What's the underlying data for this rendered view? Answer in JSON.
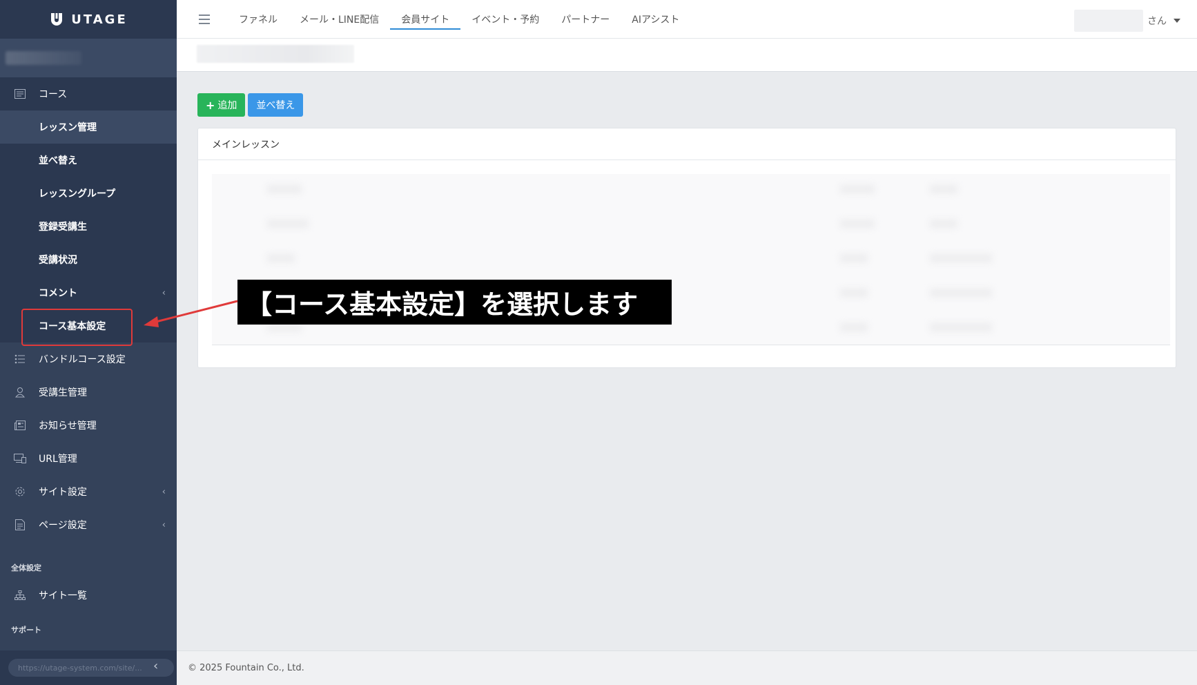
{
  "brand": {
    "name": "UTAGE"
  },
  "topbar": {
    "tabs": [
      {
        "label": "ファネル"
      },
      {
        "label": "メール・LINE配信"
      },
      {
        "label": "会員サイト",
        "active": true
      },
      {
        "label": "イベント・予約"
      },
      {
        "label": "パートナー"
      },
      {
        "label": "AIアシスト"
      }
    ],
    "user_suffix": "さん"
  },
  "sidebar": {
    "course_label": "コース",
    "course_submenu": [
      {
        "label": "レッスン管理"
      },
      {
        "label": "並べ替え"
      },
      {
        "label": "レッスングループ"
      },
      {
        "label": "登録受講生"
      },
      {
        "label": "受講状況"
      },
      {
        "label": "コメント"
      },
      {
        "label": "コース基本設定"
      }
    ],
    "items": [
      {
        "label": "バンドルコース設定",
        "icon": "list-icon"
      },
      {
        "label": "受講生管理",
        "icon": "user-icon"
      },
      {
        "label": "お知らせ管理",
        "icon": "news-icon"
      },
      {
        "label": "URL管理",
        "icon": "devices-icon"
      },
      {
        "label": "サイト設定",
        "icon": "gear-icon"
      },
      {
        "label": "ページ設定",
        "icon": "page-icon"
      }
    ],
    "section_global": "全体設定",
    "site_list_label": "サイト一覧",
    "section_support": "サポート",
    "status_url": "https://utage-system.com/site/..."
  },
  "toolbar": {
    "add_label": "追加",
    "sort_label": "並べ替え"
  },
  "card": {
    "title": "メインレッスン"
  },
  "annotation": {
    "text": "【コース基本設定】を選択します"
  },
  "footer": {
    "copyright": "© 2025 Fountain Co., Ltd."
  },
  "colors": {
    "sidebar_bg": "#34425a",
    "sidebar_dark": "#2b3850",
    "accent_blue": "#2e8bd6",
    "button_green": "#28b45a",
    "button_blue": "#3a97e8",
    "highlight_red": "#e03a3a"
  }
}
